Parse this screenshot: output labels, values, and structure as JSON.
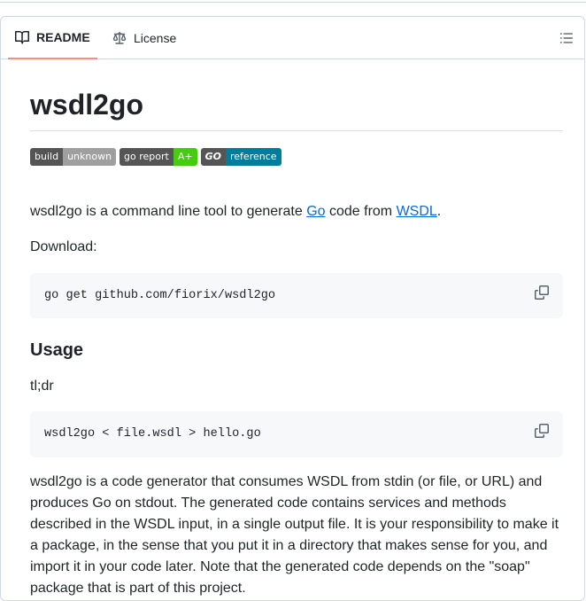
{
  "tabs": {
    "readme": "README",
    "license": "License"
  },
  "readme": {
    "title": "wsdl2go",
    "badges": {
      "build_label": "build",
      "build_value": "unknown",
      "report_label": "go report",
      "report_value": "A+",
      "ref_label": "GO",
      "ref_value": "reference"
    },
    "intro_prefix": "wsdl2go is a command line tool to generate ",
    "intro_link_go": "Go",
    "intro_middle": " code from ",
    "intro_link_wsdl": "WSDL",
    "intro_suffix": ".",
    "download_label": "Download:",
    "download_cmd": "go get github.com/fiorix/wsdl2go",
    "usage_heading": "Usage",
    "tldr": "tl;dr",
    "usage_cmd": "wsdl2go < file.wsdl > hello.go",
    "description": "wsdl2go is a code generator that consumes WSDL from stdin (or file, or URL) and produces Go on stdout. The generated code contains services and methods described in the WSDL input, in a single output file. It is your responsibility to make it a package, in the sense that you put it in a directory that makes sense for you, and import it in your code later. Note that the generated code depends on the \"soap\" package that is part of this project."
  },
  "colors": {
    "tab_underline": "#fd8c73",
    "link": "#0969da",
    "code_bg": "#f6f8fa"
  },
  "icons": [
    "book-icon",
    "scale-icon",
    "list-unordered-icon",
    "copy-icon"
  ]
}
